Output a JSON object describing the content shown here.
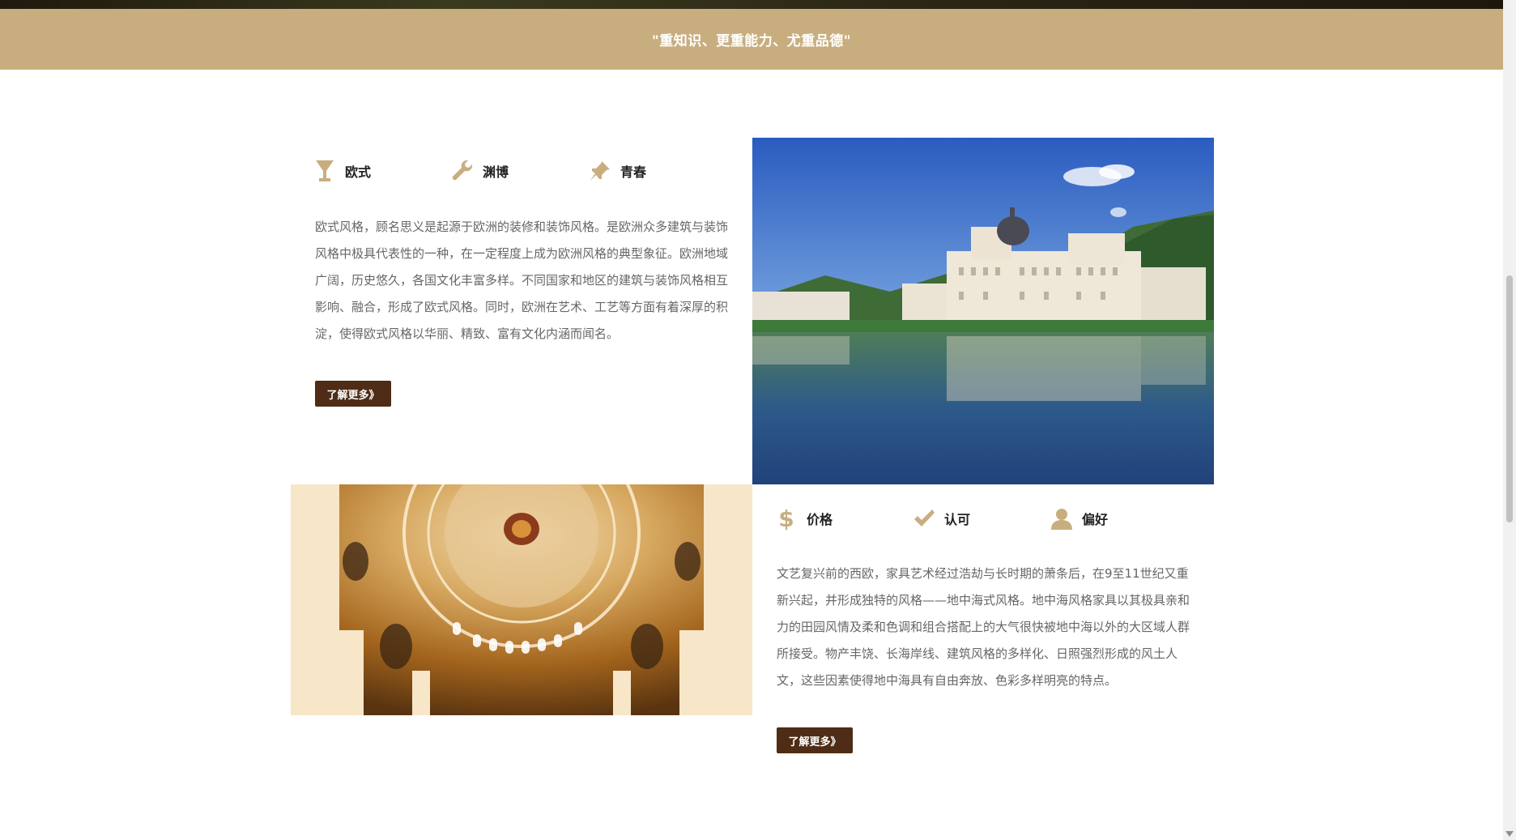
{
  "banner": {
    "motto": "\"重知识、更重能力、尤重品德\""
  },
  "section_one": {
    "features": [
      {
        "label": "欧式",
        "icon": "goblet-icon"
      },
      {
        "label": "渊博",
        "icon": "wrench-icon"
      },
      {
        "label": "青春",
        "icon": "pushpin-icon"
      }
    ],
    "description": "欧式风格，顾名思义是起源于欧洲的装修和装饰风格。是欧洲众多建筑与装饰风格中极具代表性的一种，在一定程度上成为欧洲风格的典型象征。欧洲地域广阔，历史悠久，各国文化丰富多样。不同国家和地区的建筑与装饰风格相互影响、融合，形成了欧式风格。同时，欧洲在艺术、工艺等方面有着深厚的积淀，使得欧式风格以华丽、精致、富有文化内涵而闻名。",
    "button_label": "了解更多》",
    "image": "castle-by-lake-photo"
  },
  "section_two": {
    "features": [
      {
        "label": "价格",
        "icon": "dollar-icon"
      },
      {
        "label": "认可",
        "icon": "checkmark-icon"
      },
      {
        "label": "偏好",
        "icon": "user-icon"
      }
    ],
    "description": "文艺复兴前的西欧，家具艺术经过浩劫与长时期的萧条后，在9至11世纪又重新兴起，并形成独特的风格——地中海式风格。地中海风格家具以其极具亲和力的田园风情及柔和色调和组合搭配上的大气很快被地中海以外的大区域人群所接受。物产丰饶、长海岸线、建筑风格的多样化、日照强烈形成的风土人文，这些因素使得地中海具有自由奔放、色彩多样明亮的特点。",
    "button_label": "了解更多》",
    "image": "dome-interior-photo"
  },
  "colors": {
    "banner": "#c8ae7f",
    "button": "#4e2c15",
    "icon_gold": "#c8ae7f"
  }
}
